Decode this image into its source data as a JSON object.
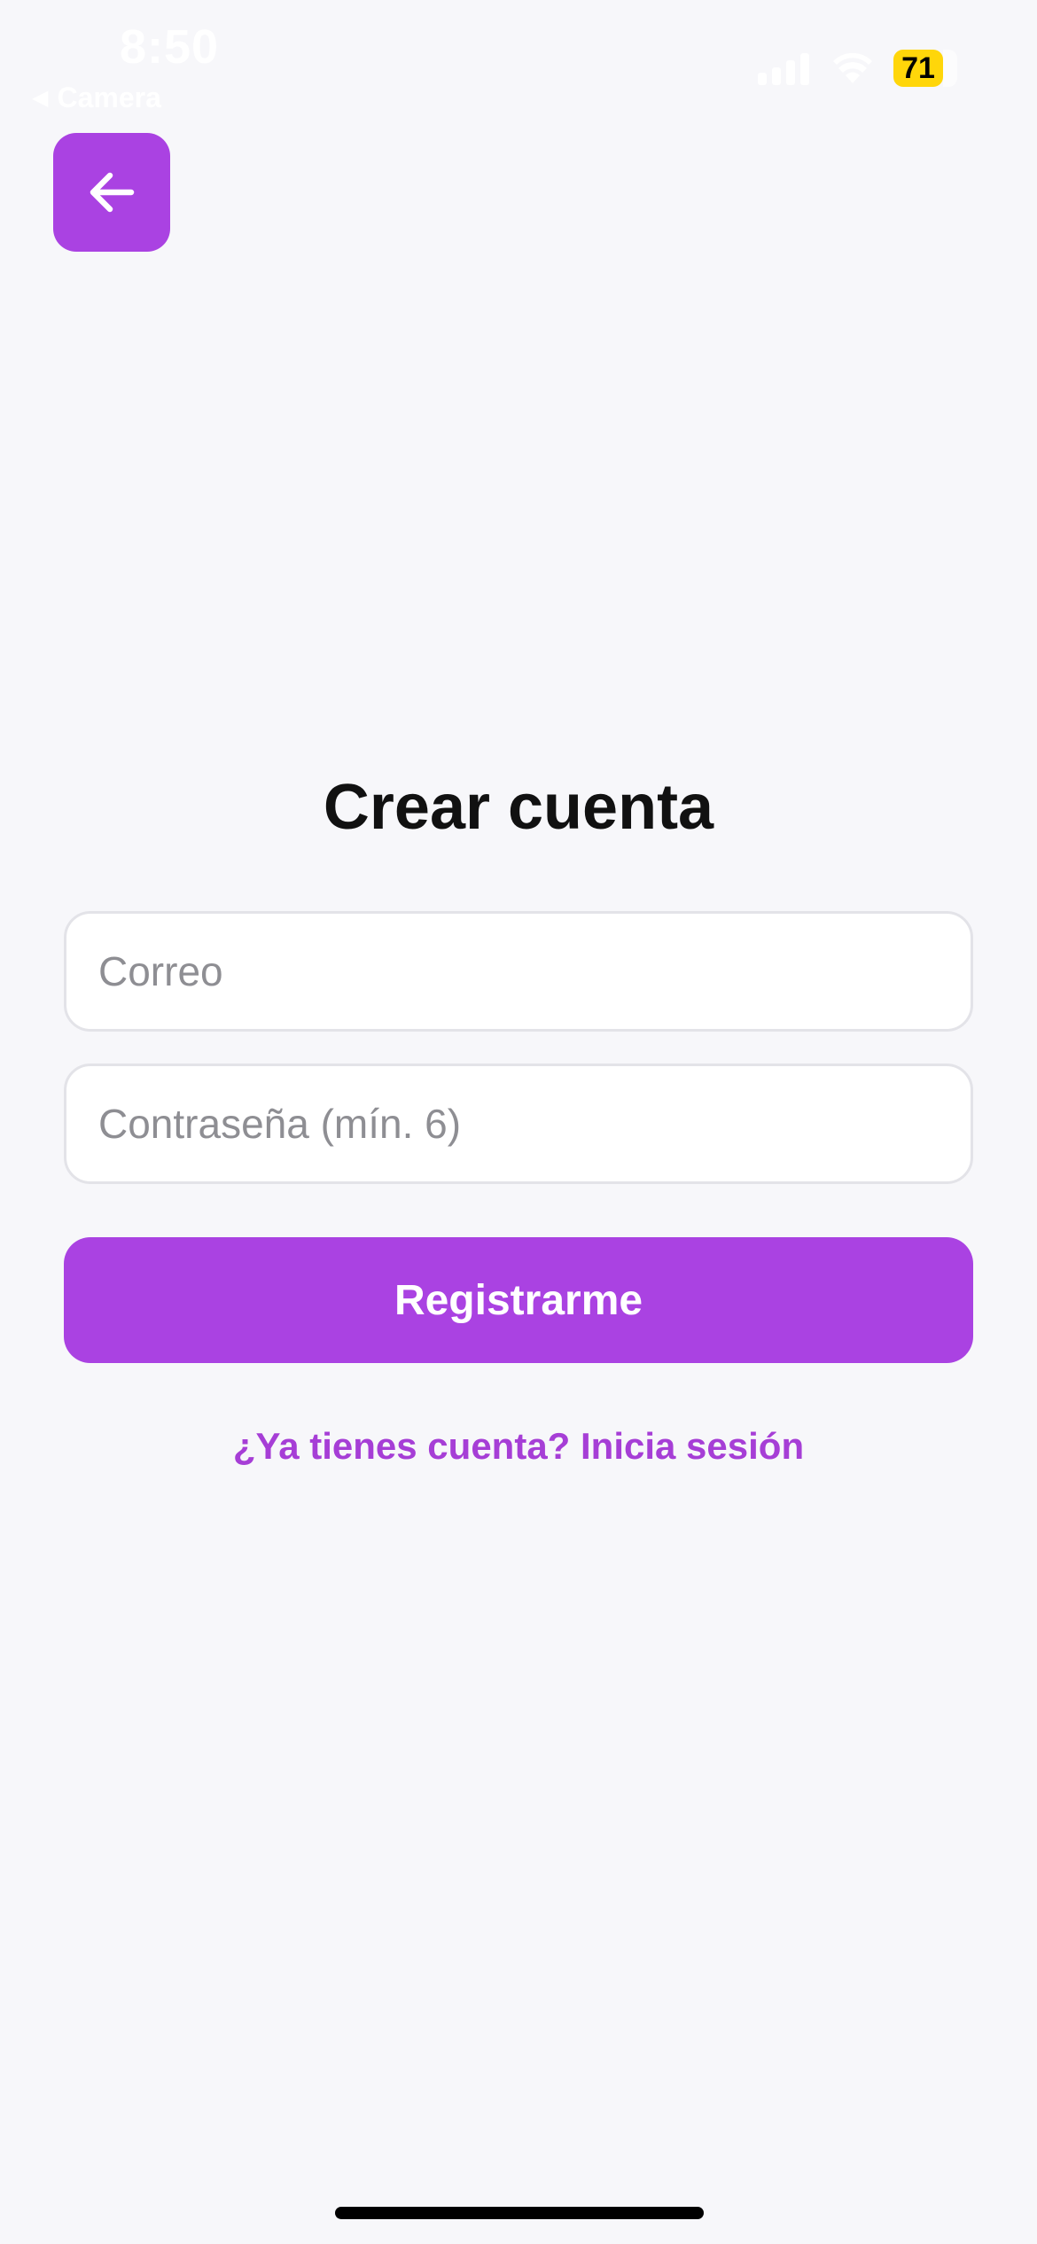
{
  "status_bar": {
    "time": "8:50",
    "back_app_label": "Camera",
    "back_app_glyph": "◀",
    "battery_level": "71",
    "battery_color": "#FFD60A"
  },
  "header": {
    "back_icon": "arrow-left-icon"
  },
  "form": {
    "title": "Crear cuenta",
    "email_placeholder": "Correo",
    "email_value": "",
    "password_placeholder": "Contraseña (mín. 6)",
    "password_value": "",
    "submit_label": "Registrarme",
    "login_link": "¿Ya tienes cuenta? Inicia sesión"
  },
  "colors": {
    "accent": "#AA42E2",
    "link": "#A63ED6",
    "background": "#F7F7FA"
  }
}
